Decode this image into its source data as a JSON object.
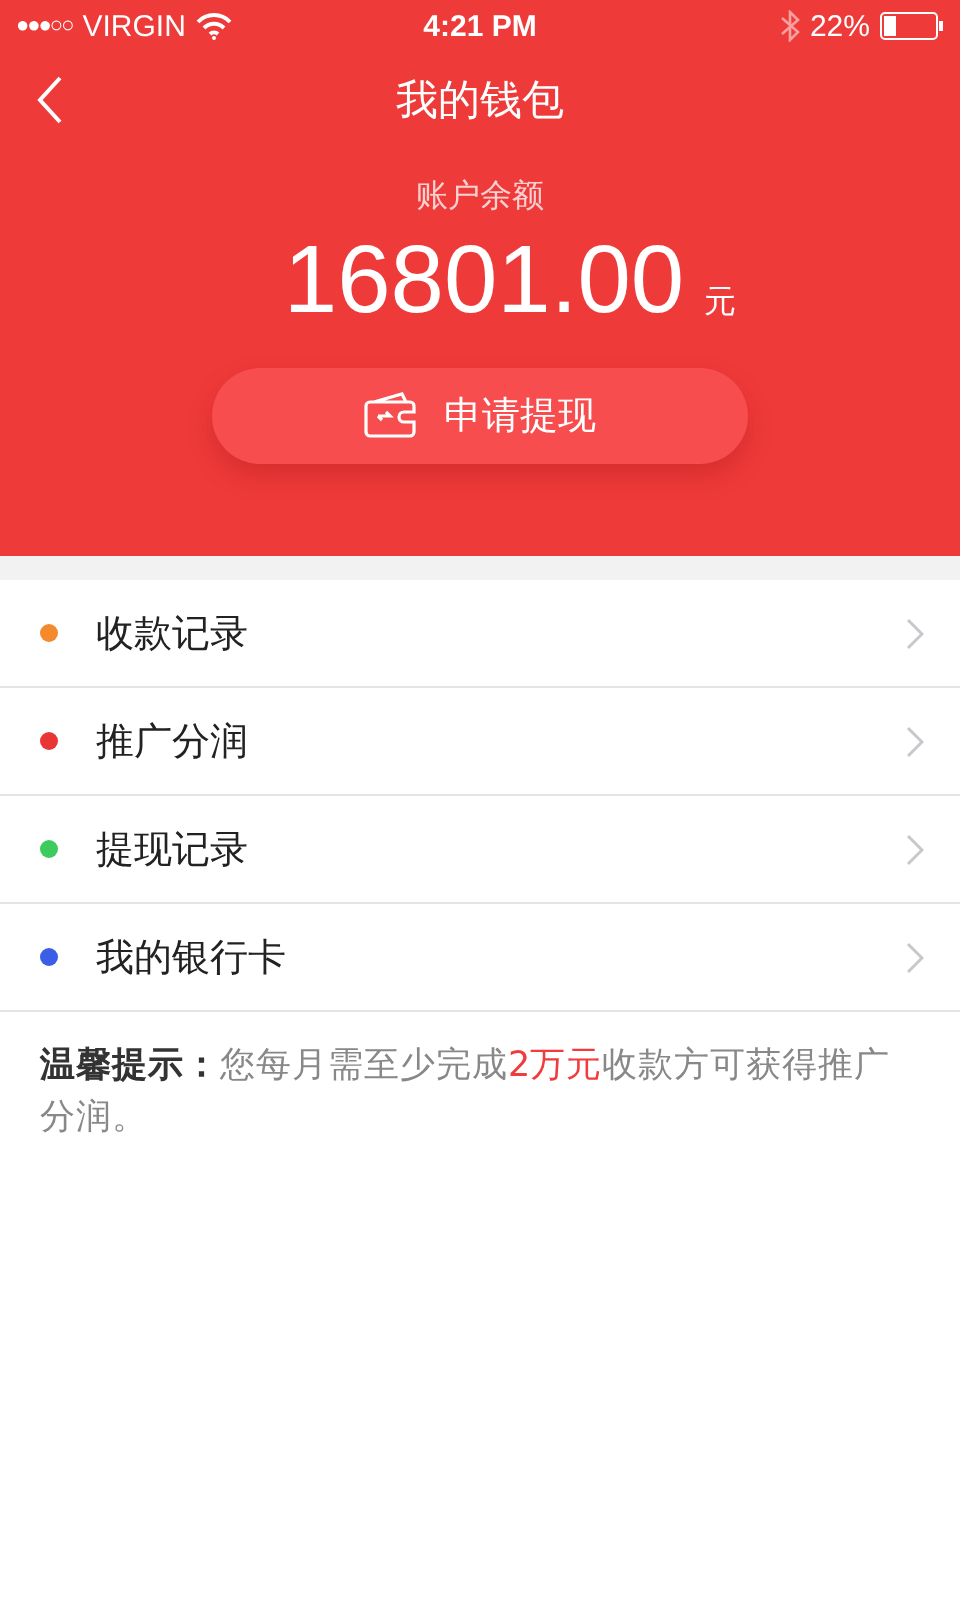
{
  "status_bar": {
    "carrier": "VIRGIN",
    "signal_dots": "●●●○○",
    "time": "4:21 PM",
    "battery": "22%"
  },
  "nav": {
    "title": "我的钱包"
  },
  "balance": {
    "label": "账户余额",
    "amount": "16801.00",
    "unit": "元"
  },
  "withdraw_button": {
    "label": "申请提现"
  },
  "menu": [
    {
      "label": "收款记录",
      "color": "#f5892e"
    },
    {
      "label": "推广分润",
      "color": "#ea3535"
    },
    {
      "label": "提现记录",
      "color": "#3ecb5e"
    },
    {
      "label": "我的银行卡",
      "color": "#3b5ee6"
    }
  ],
  "tip": {
    "title": "温馨提示：",
    "segments": [
      {
        "kind": "plain",
        "text": "您每月需至少完成"
      },
      {
        "kind": "highlight",
        "text": "2万元"
      },
      {
        "kind": "plain",
        "text": "收款方可获得推广分润。"
      }
    ]
  }
}
